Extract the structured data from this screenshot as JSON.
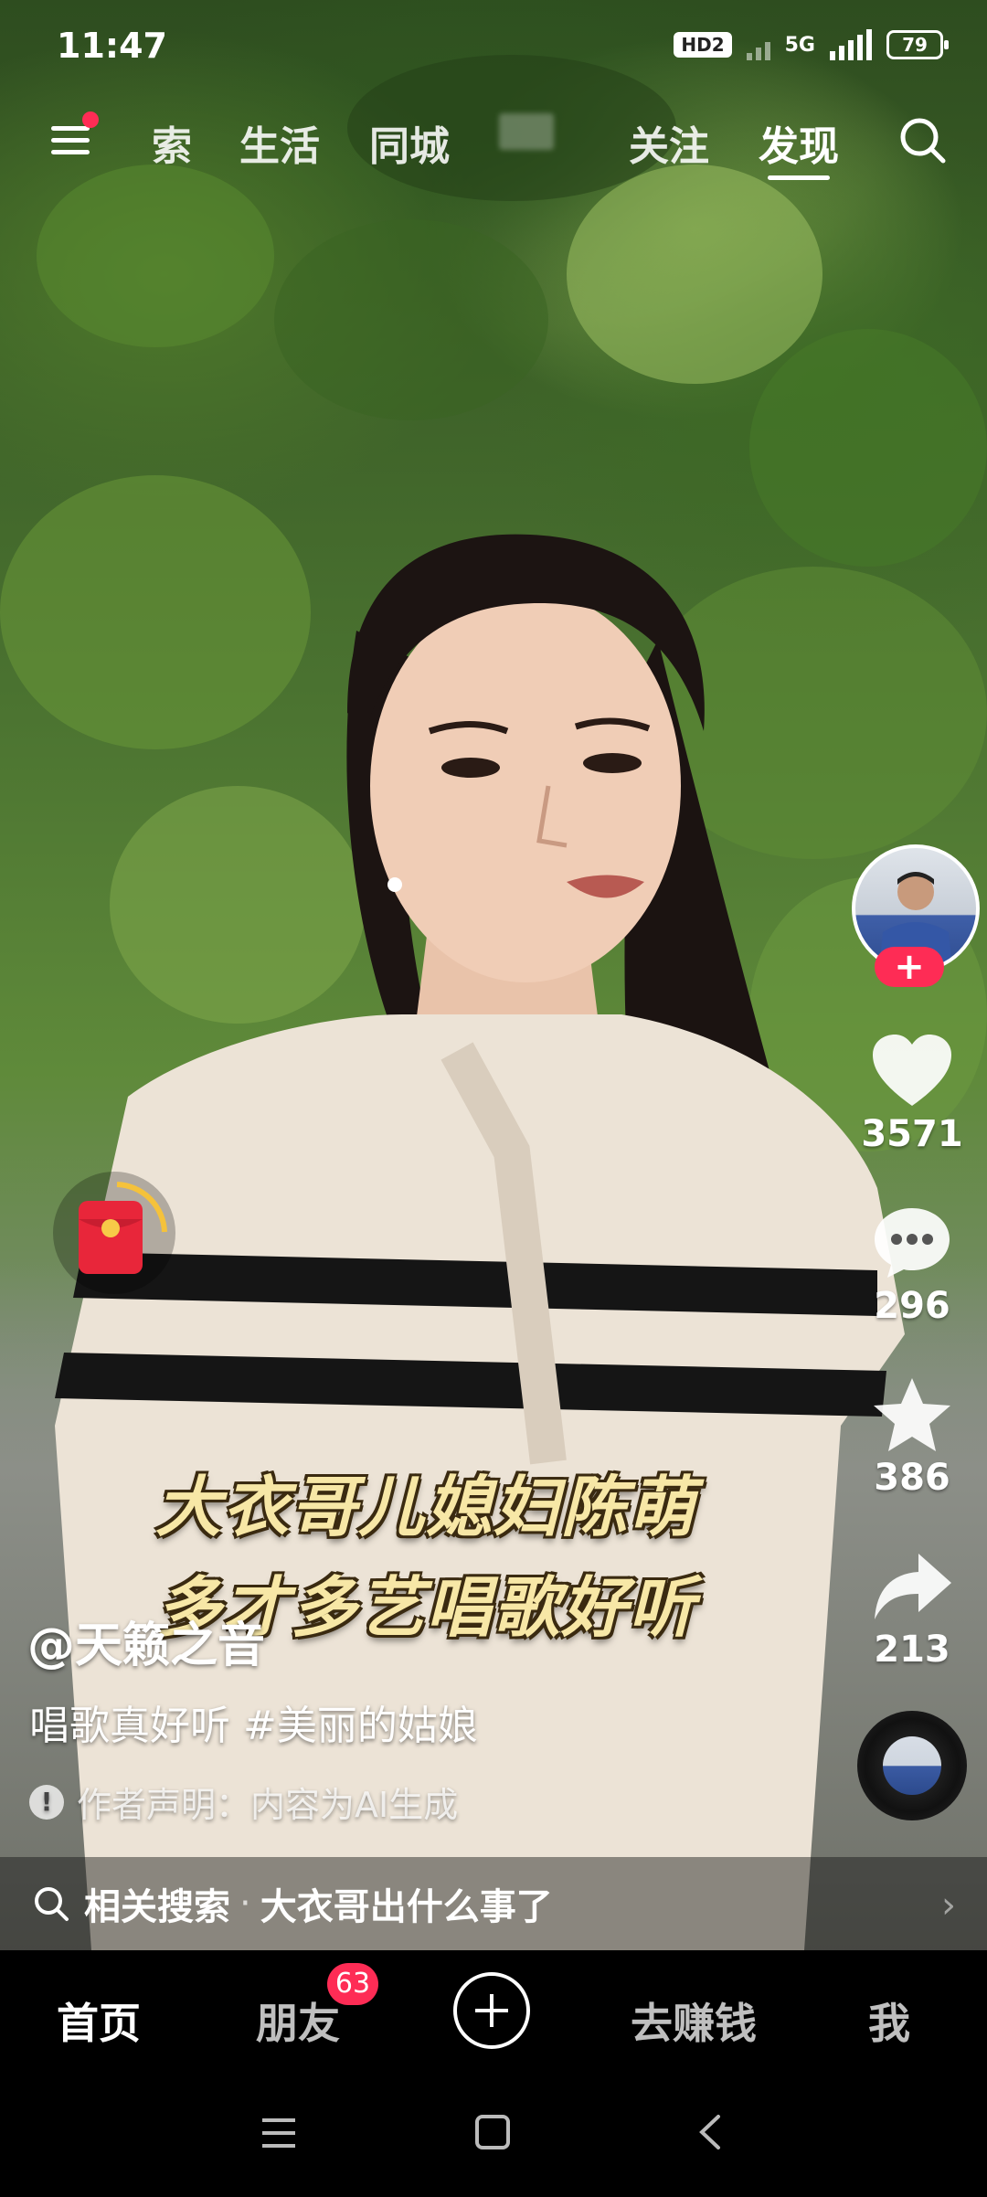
{
  "status_bar": {
    "time": "11:47",
    "hd_label": "HD2",
    "network": "5G",
    "battery": "79"
  },
  "top_nav": {
    "tabs": [
      {
        "label": "索",
        "active": false
      },
      {
        "label": "生活",
        "active": false
      },
      {
        "label": "同城",
        "active": false
      },
      {
        "label": "关注",
        "active": false
      },
      {
        "label": "发现",
        "active": true
      }
    ]
  },
  "video": {
    "caption_lines": [
      "大衣哥儿媳妇陈萌",
      "多才多艺唱歌好听"
    ],
    "author": "@天籁之音",
    "description": "唱歌真好听 #美丽的姑娘",
    "notice": "作者声明：内容为AI生成",
    "related_search_label": "相关搜索",
    "related_search_query": "大衣哥出什么事了"
  },
  "actions": {
    "likes": "3571",
    "comments": "296",
    "favorites": "386",
    "shares": "213"
  },
  "bottom_nav": {
    "home": "首页",
    "friends": "朋友",
    "friends_badge": "63",
    "earn": "去赚钱",
    "me": "我"
  },
  "colors": {
    "accent": "#fe2c55",
    "caption": "#f7e7a6"
  }
}
